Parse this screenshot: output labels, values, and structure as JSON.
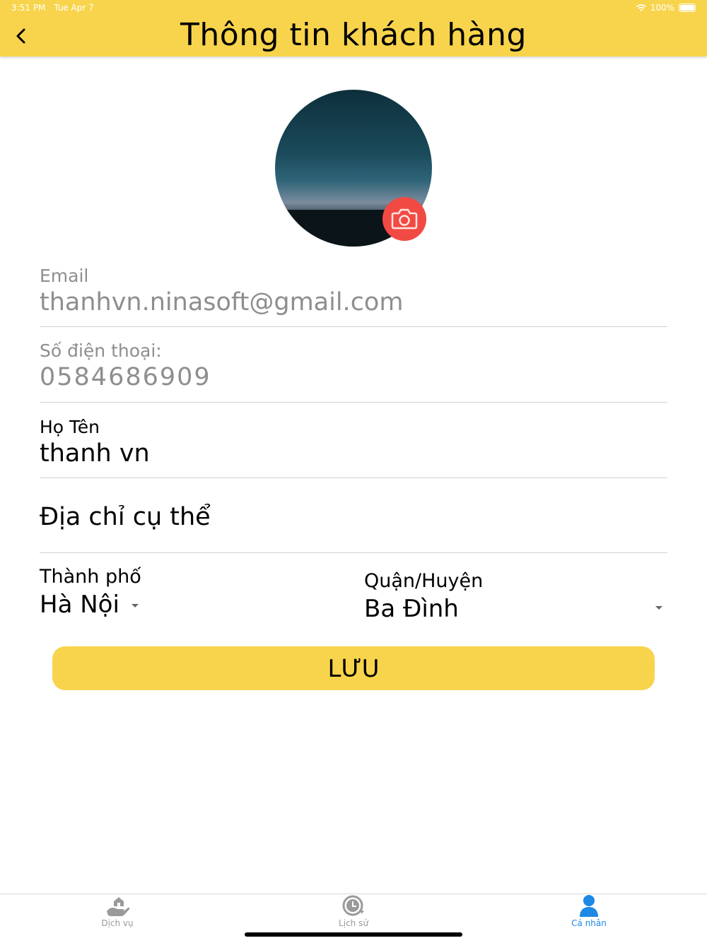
{
  "status_bar": {
    "time": "3:51 PM",
    "date": "Tue Apr 7",
    "battery": "100%"
  },
  "header": {
    "title": "Thông tin khách hàng"
  },
  "form": {
    "email": {
      "label": "Email",
      "value": "thanhvn.ninasoft@gmail.com"
    },
    "phone": {
      "label": "Số điện thoại:",
      "value": "0584686909"
    },
    "name": {
      "label": "Họ Tên",
      "value": "thanh vn"
    },
    "address": {
      "placeholder": "Địa chỉ cụ thể"
    },
    "city": {
      "label": "Thành phố",
      "value": "Hà Nội"
    },
    "district": {
      "label": "Quận/Huyện",
      "value": "Ba Đình"
    }
  },
  "save_button": {
    "label": "LƯU"
  },
  "tabs": [
    {
      "label": "Dịch vụ",
      "icon": "service-hand-house-icon",
      "active": false
    },
    {
      "label": "Lịch sử",
      "icon": "history-clock-icon",
      "active": false
    },
    {
      "label": "Cá nhân",
      "icon": "person-icon",
      "active": true
    }
  ],
  "colors": {
    "accent": "#f8d44c",
    "camera": "#f14a43",
    "active_tab": "#1e88e5",
    "muted_text": "#8e8e8e"
  }
}
